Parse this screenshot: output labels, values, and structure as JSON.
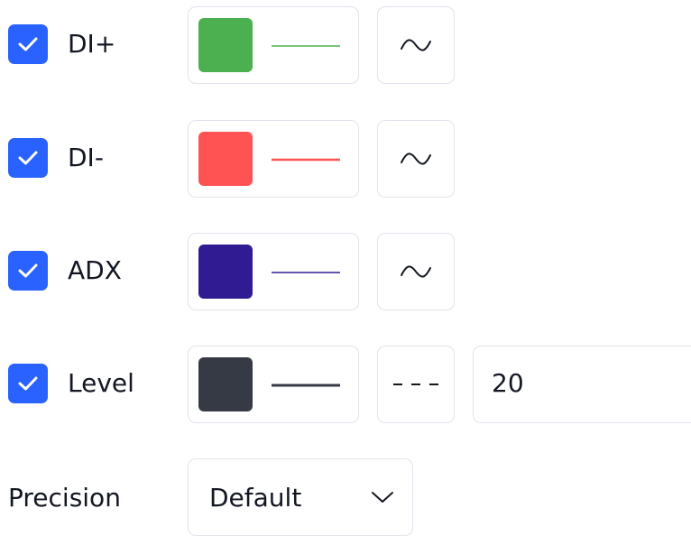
{
  "plots": [
    {
      "label": "DI+",
      "checked": true,
      "color": "#4caf50",
      "line_color": "#4caf50",
      "style_icon": "wave-icon"
    },
    {
      "label": "DI-",
      "checked": true,
      "color": "#ff5252",
      "line_color": "#ff5252",
      "style_icon": "wave-icon"
    },
    {
      "label": "ADX",
      "checked": true,
      "color": "#311b92",
      "line_color": "#311b92",
      "style_icon": "wave-icon"
    },
    {
      "label": "Level",
      "checked": true,
      "color": "#363a45",
      "line_color": "#363a45",
      "style_icon": "dashed-line-icon",
      "value": "20"
    }
  ],
  "precision": {
    "label": "Precision",
    "selected": "Default",
    "icon": "chevron-down-icon"
  }
}
